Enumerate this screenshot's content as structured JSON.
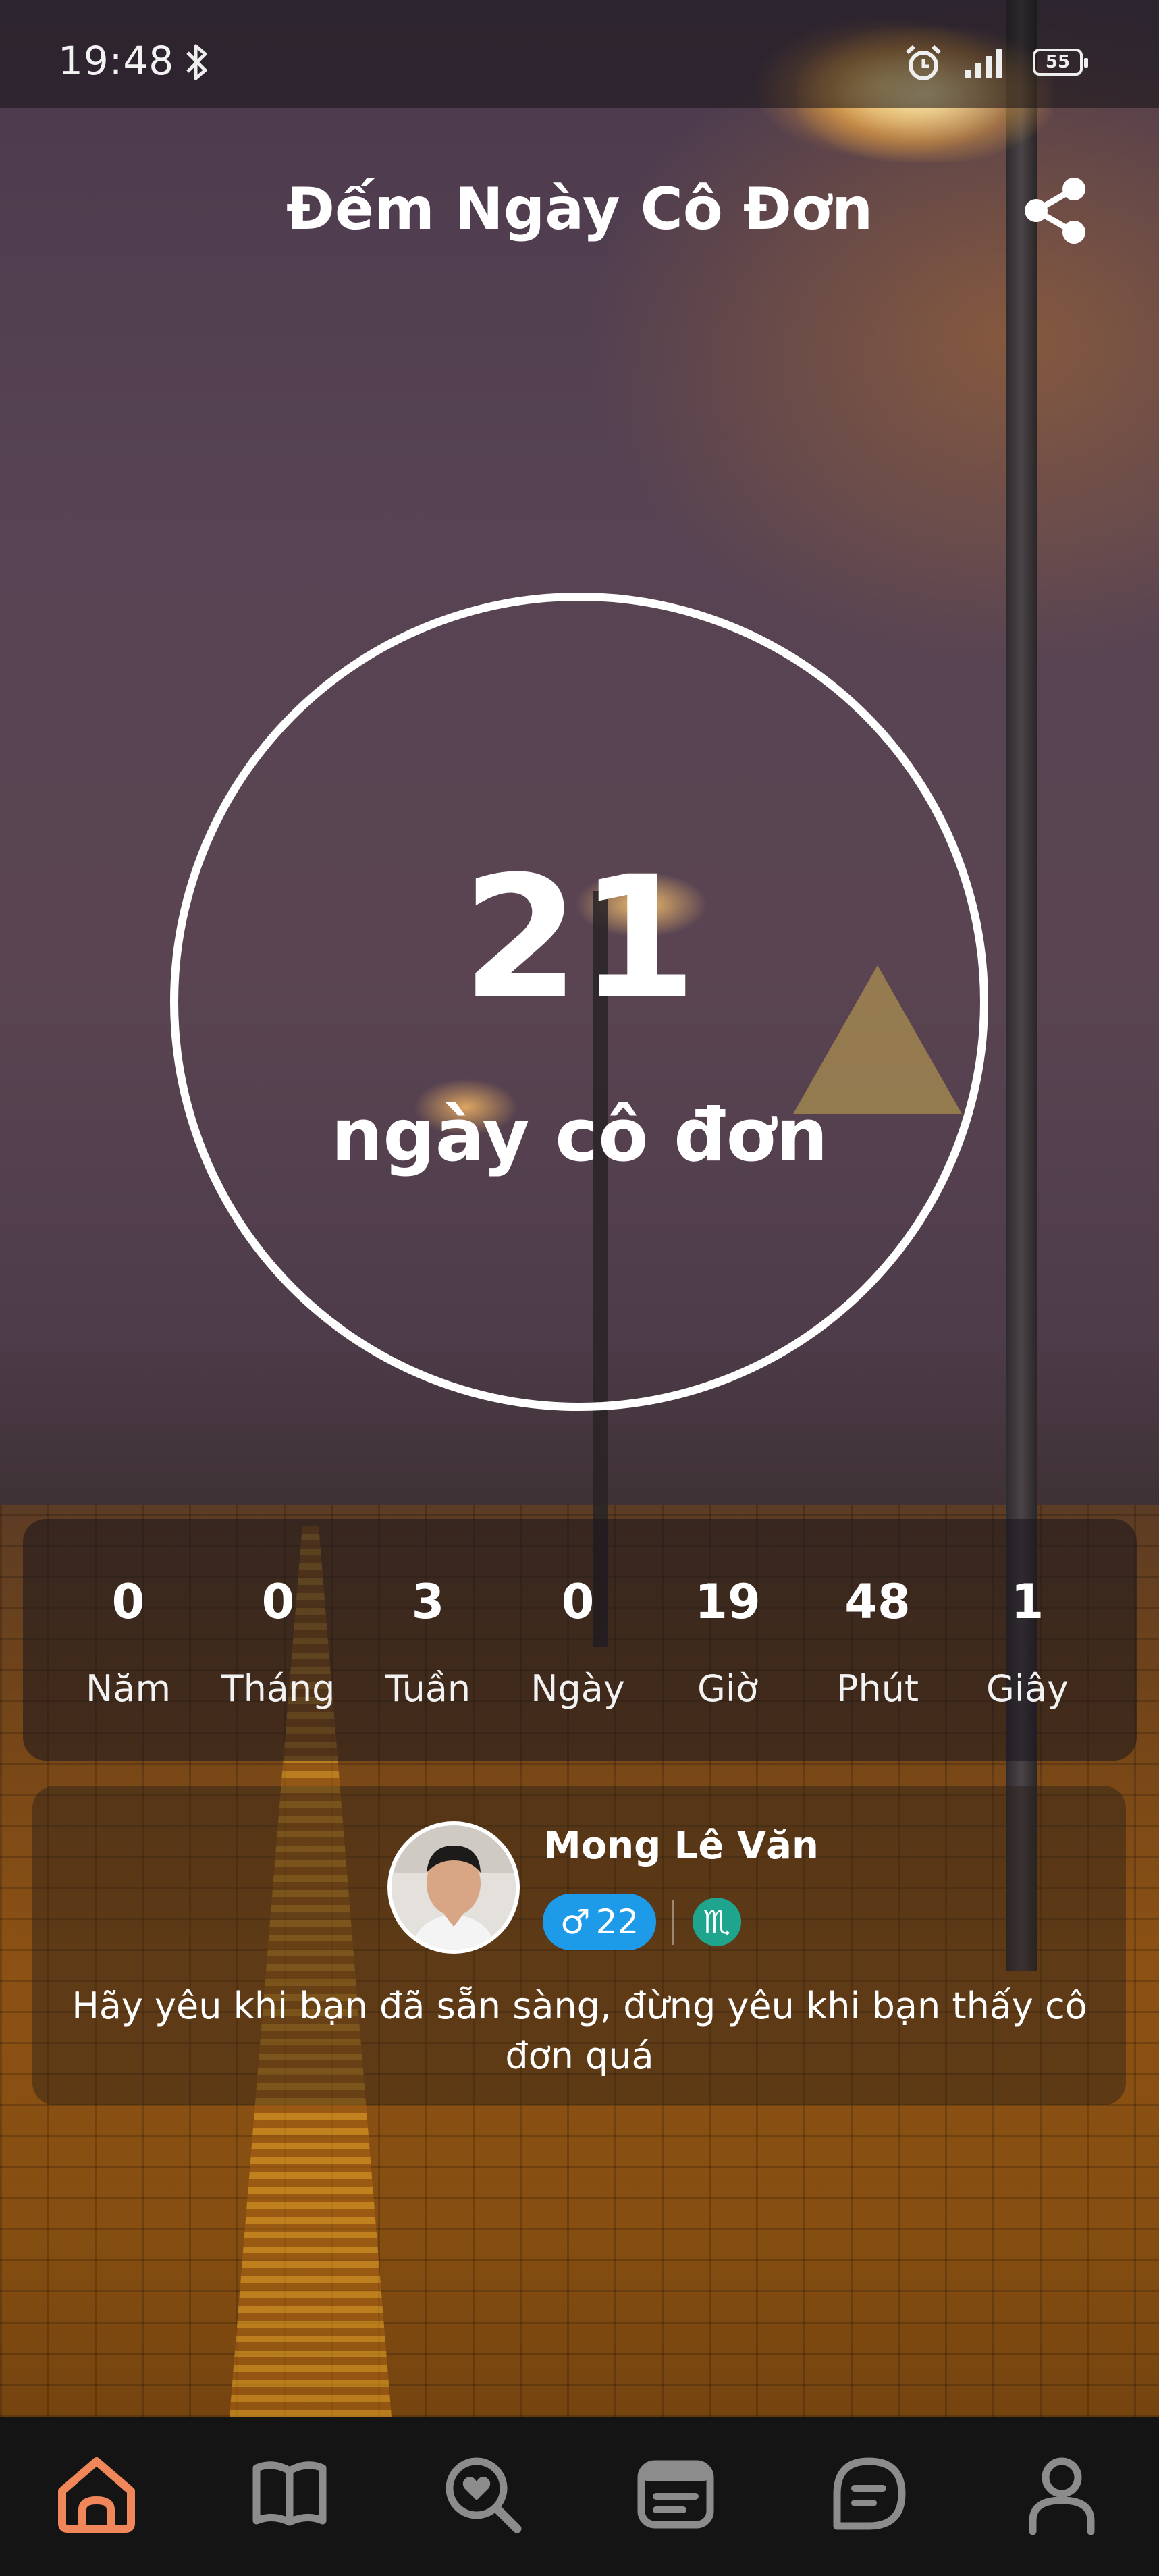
{
  "status_bar": {
    "time": "19:48",
    "battery": "55",
    "icons": [
      "bluetooth-icon",
      "alarm-icon",
      "signal-icon",
      "battery-icon"
    ]
  },
  "header": {
    "title": "Đếm Ngày Cô Đơn",
    "share_icon": "share-icon"
  },
  "counter": {
    "days": "21",
    "label": "ngày cô đơn"
  },
  "breakdown": [
    {
      "value": "0",
      "label": "Năm"
    },
    {
      "value": "0",
      "label": "Tháng"
    },
    {
      "value": "3",
      "label": "Tuần"
    },
    {
      "value": "0",
      "label": "Ngày"
    },
    {
      "value": "19",
      "label": "Giờ"
    },
    {
      "value": "48",
      "label": "Phút"
    },
    {
      "value": "1",
      "label": "Giây"
    }
  ],
  "profile": {
    "name": "Mong Lê Văn",
    "gender_symbol": "♂",
    "age": "22",
    "zodiac_symbol": "♏",
    "quote": "Hãy yêu khi bạn đã sẵn sàng, đừng yêu khi bạn thấy cô đơn quá"
  },
  "bottom_nav": {
    "items": [
      "home-icon",
      "book-icon",
      "search-heart-icon",
      "news-icon",
      "chat-icon",
      "profile-icon"
    ],
    "active_color": "#f0875a",
    "inactive_color": "#8c8c8c"
  },
  "colors": {
    "gender_badge": "#1e9be8",
    "zodiac_badge": "#1fa58e"
  }
}
